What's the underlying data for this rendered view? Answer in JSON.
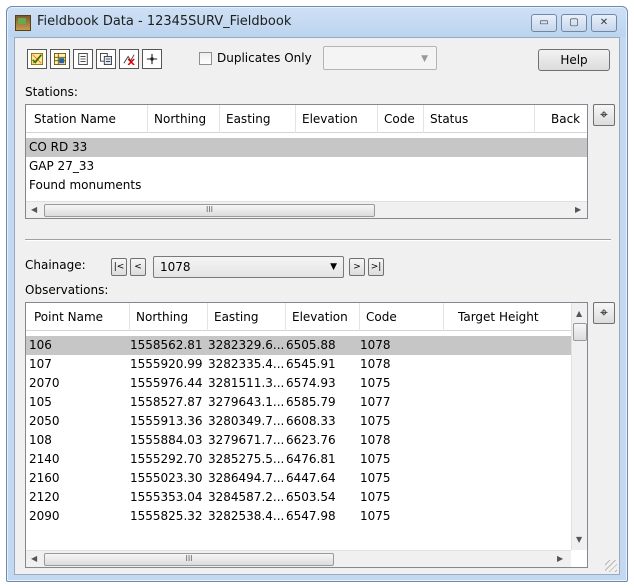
{
  "window": {
    "title": "Fieldbook Data - 12345SURV_Fieldbook"
  },
  "title_buttons": {
    "minimize": "▭",
    "maximize": "▢",
    "close": "✕"
  },
  "toolbar": {
    "icons": [
      "checked-chart-icon",
      "table-icon",
      "document-icon",
      "copy-icon",
      "delete-points-icon",
      "crosshair-icon"
    ],
    "duplicates_label": "Duplicates Only",
    "duplicates_checked": false,
    "dropdown_value": "",
    "help_label": "Help"
  },
  "stations": {
    "label": "Stations:",
    "columns": [
      "Station Name",
      "Northing",
      "Easting",
      "Elevation",
      "Code",
      "Status",
      "Back"
    ],
    "rows": [
      "CO RD 33",
      "GAP 27_33",
      "Found monuments"
    ],
    "selected_index": 0,
    "scroll_thumb": "III"
  },
  "chainage": {
    "label": "Chainage:",
    "first": "|<",
    "prev": "<",
    "value": "1078",
    "next": ">",
    "last": ">|"
  },
  "observations": {
    "label": "Observations:",
    "columns": [
      "Point Name",
      "Northing",
      "Easting",
      "Elevation",
      "Code",
      "Target Height"
    ],
    "rows": [
      [
        "106",
        "1558562.81",
        "3282329.6...",
        "6505.88",
        "1078",
        ""
      ],
      [
        "107",
        "1555920.99",
        "3282335.4...",
        "6545.91",
        "1078",
        ""
      ],
      [
        "2070",
        "1555976.44",
        "3281511.3...",
        "6574.93",
        "1075",
        ""
      ],
      [
        "105",
        "1558527.87",
        "3279643.1...",
        "6585.79",
        "1077",
        ""
      ],
      [
        "2050",
        "1555913.36",
        "3280349.7...",
        "6608.33",
        "1075",
        ""
      ],
      [
        "108",
        "1555884.03",
        "3279671.7...",
        "6623.76",
        "1078",
        ""
      ],
      [
        "2140",
        "1555292.70",
        "3285275.5...",
        "6476.81",
        "1075",
        ""
      ],
      [
        "2160",
        "1555023.30",
        "3286494.7...",
        "6447.64",
        "1075",
        ""
      ],
      [
        "2120",
        "1555353.04",
        "3284587.2...",
        "6503.54",
        "1075",
        ""
      ],
      [
        "2090",
        "1555825.32",
        "3282538.4...",
        "6547.98",
        "1075",
        ""
      ]
    ],
    "selected_index": 0,
    "scroll_thumb": "III"
  },
  "side_button": "⌖"
}
